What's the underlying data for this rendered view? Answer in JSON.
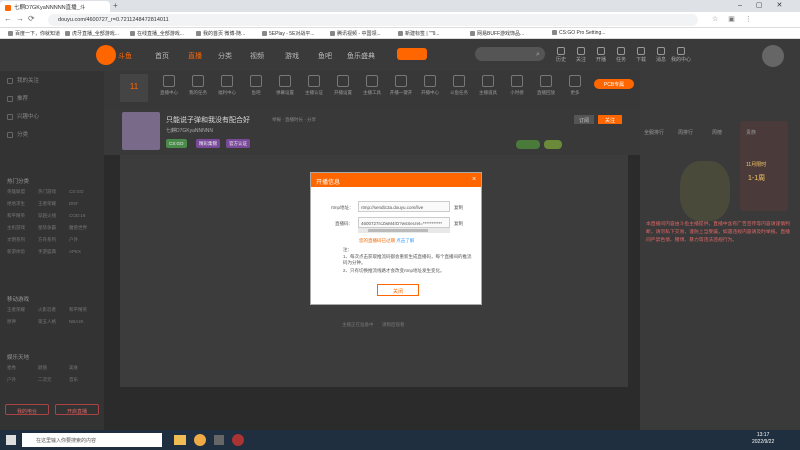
{
  "browser": {
    "tab_title": "七麒D7GKyaNNNNN直播_斗",
    "url": "douyu.com/4600727_r=0.7211248472814011",
    "bookmarks": [
      "百度一下，你就知道",
      "虎牙直播_全部游戏...",
      "在线直播_全部游戏...",
      "我的首页 微博-随...",
      "5EPlay - 5E对战平...",
      "腾讯视频 - 中国领...",
      "新建标签 | \"\"9...",
      "网易BUFF游戏饰品...",
      "CS:GO Pro Setting..."
    ]
  },
  "site": {
    "nav": [
      "首页",
      "直播",
      "分类",
      "视频",
      "游戏",
      "鱼吧",
      "鱼乐盛典"
    ],
    "header_icons": [
      "历史",
      "关注",
      "开播",
      "任务",
      "下载",
      "消息",
      "我的中心"
    ]
  },
  "sidebar": {
    "top_items": [
      "我的关注",
      "推荐",
      "兴趣中心",
      "分类"
    ],
    "game_heading": "热门分类",
    "game_grid": [
      "英雄联盟",
      "热门游戏",
      "CS:GO",
      "绝地求生",
      "王者荣耀",
      "DNF",
      "和平精英",
      "穿越火线",
      "COD:16",
      "主机游戏",
      "星际争霸",
      "魔兽世界",
      "文明系列",
      "方舟系列",
      "户外",
      "新游体验",
      "手游盛典",
      "APEX"
    ],
    "mobile_heading": "移动游戏",
    "mobile_grid": [
      "王者荣耀",
      "火影忍者",
      "和平精英",
      "原神",
      "第五人格",
      "NBA2K"
    ],
    "entertainment_heading": "娱乐天地",
    "ent_grid": [
      "星秀",
      "颜值",
      "美食",
      "户外",
      "二次元",
      "音乐"
    ],
    "bottom_buttons": [
      "我的电台",
      "开启直播"
    ]
  },
  "toolbar": {
    "date_badge": "11",
    "items": [
      "直播中心",
      "我的任务",
      "福利中心",
      "鱼吧",
      "弹幕设置",
      "主播认证",
      "开播设置",
      "主播工具",
      "开播一键开",
      "开播中心",
      "斗鱼任务",
      "主播道具",
      "小时榜",
      "直播回放",
      "更多"
    ],
    "right_btn": "PCB专属"
  },
  "room": {
    "title": "只能说子弹和我没有配合好",
    "meta": "举报 · 直播时长 · 分享",
    "streamer": "七麒D7GKyaNNNNN",
    "tags": [
      "CS:GO",
      "精彩集锦",
      "官方认证"
    ],
    "follow": "关注",
    "sub": "订阅"
  },
  "right_panel": {
    "tabs": [
      "全服排行",
      "周排行",
      "周榜",
      "贵族"
    ],
    "notice": "本直播间内容由斗鱼主播提供，直播中含有广告宣传等内容请谨慎判断，请勿私下交易，谨防上当受骗，如遇违规内容请及时举报。直播间严禁色情、赌博、暴力等违法违规行为。",
    "promo": "11月限时",
    "promo2": "1-1周"
  },
  "player": {
    "bottom_links": [
      "主播正在准备中",
      "请稍后观看"
    ]
  },
  "dialog": {
    "title": "开播信息",
    "rtmp_label": "rtmp地址：",
    "rtmp_value": "rtmp://sendtc3a.douyu.com/live",
    "key_label": "直播码：",
    "key_value": "4600727rcZwM4rD?wsSecret=***********",
    "copy": "复制",
    "warn": "您的直播码已过期",
    "warn_link": "点击了解",
    "notes_head": "注：",
    "note1": "1、每次点击获取推流码都会重新生成直播码，每个直播间的推流码为分钟。",
    "note2": "2、只有切换推流线路才会改变rtmp地址发生变化。",
    "close": "关闭"
  },
  "taskbar": {
    "search": "在这里输入你要搜索的内容",
    "time": "13:17",
    "date": "2022/9/22"
  },
  "colors": {
    "accent": "#ff6600",
    "header": "#3a3a3a"
  }
}
